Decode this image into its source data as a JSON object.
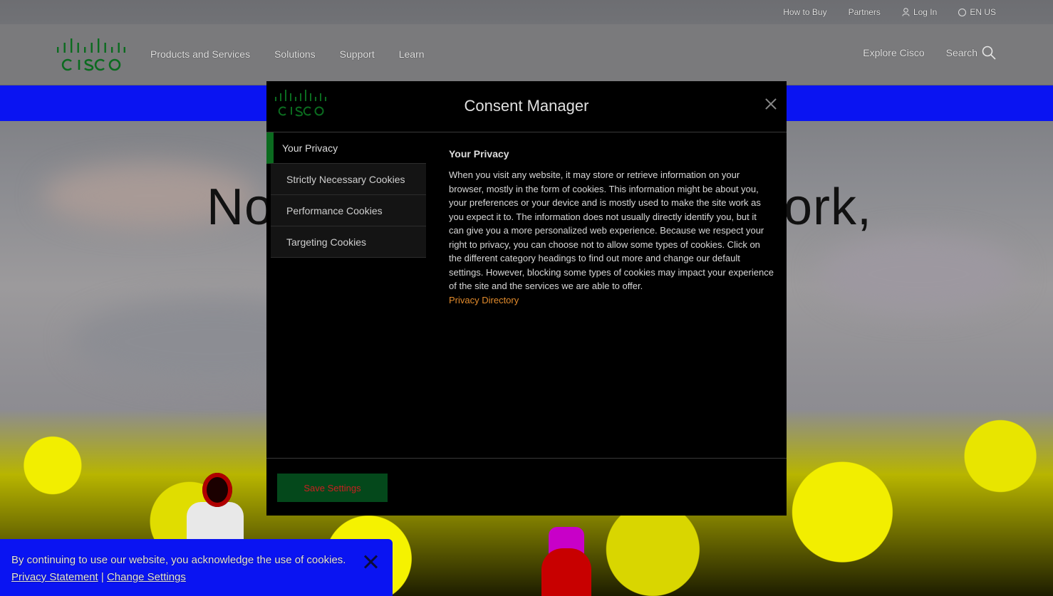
{
  "utility_bar": {
    "how_to_buy": "How to Buy",
    "partners": "Partners",
    "log_in": "Log In",
    "language": "EN US"
  },
  "main_nav": {
    "items": [
      "Products and Services",
      "Solutions",
      "Support",
      "Learn"
    ],
    "explore": "Explore Cisco",
    "search": "Search"
  },
  "hero": {
    "text_left": "No",
    "text_right": "ork,"
  },
  "modal": {
    "title": "Consent Manager",
    "tabs": [
      "Your Privacy",
      "Strictly Necessary Cookies",
      "Performance Cookies",
      "Targeting Cookies"
    ],
    "content_heading": "Your Privacy",
    "content_body": "When you visit any website, it may store or retrieve information on your browser, mostly in the form of cookies. This information might be about you, your preferences or your device and is mostly used to make the site work as you expect it to. The information does not usually directly identify you, but it can give you a more personalized web experience. Because we respect your right to privacy, you can choose not to allow some types of cookies. Click on the different category headings to find out more and change our default settings. However, blocking some types of cookies may impact your experience of the site and the services we are able to offer.",
    "privacy_link": "Privacy Directory",
    "save_button": "Save Settings"
  },
  "banner": {
    "text": "By continuing to use our website, you acknowledge the use of cookies.",
    "privacy_statement": "Privacy Statement",
    "separator": "|",
    "change_settings": "Change Settings"
  },
  "colors": {
    "brand_green": "#0b6b1f",
    "link_orange": "#e28b2c",
    "banner_blue": "#0a14f2",
    "modal_bg": "#000000"
  }
}
